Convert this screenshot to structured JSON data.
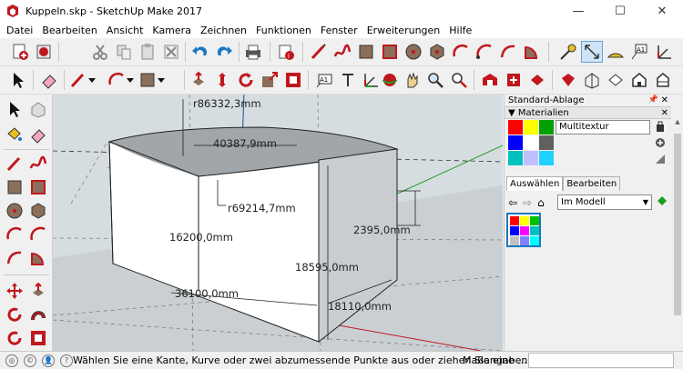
{
  "window": {
    "title": "Kuppeln.skp - SketchUp Make 2017",
    "minimize_glyph": "—",
    "maximize_glyph": "☐",
    "close_glyph": "✕"
  },
  "menu": [
    "Datei",
    "Bearbeiten",
    "Ansicht",
    "Kamera",
    "Zeichnen",
    "Funktionen",
    "Fenster",
    "Erweiterungen",
    "Hilfe"
  ],
  "viewport": {
    "dimensions": [
      "r86332,3mm",
      "40387,9mm",
      "r69214,7mm",
      "16200,0mm",
      "2395,0mm",
      "18595,0mm",
      "36100,0mm",
      "18110,0mm"
    ]
  },
  "tray": {
    "title": "Standard-Ablage",
    "panel_header": "▼ Materialien",
    "material_name": "Multitextur",
    "tabs": [
      "Auswählen",
      "Bearbeiten"
    ],
    "collection_select": "Im Modell",
    "swatches": [
      "#ff0000",
      "#ffff00",
      "#00a000",
      "#0000ff",
      "#ffffff",
      "#606060",
      "#00c0c0",
      "#c0c0ff",
      "#20d0ff"
    ],
    "thumb_swatches": [
      "#ff0000",
      "#ffff00",
      "#00c000",
      "#0000ff",
      "#ff00ff",
      "#00c0c0",
      "#c0c0c0",
      "#8080ff",
      "#00ffff"
    ]
  },
  "status": {
    "message": "Wählen Sie eine Kante, Kurve oder zwei abzumessende Punkte aus oder ziehen Sie eine ...",
    "measure_label": "Maßangaben",
    "measure_value": ""
  },
  "colors": {
    "accent_red": "#c0181e",
    "viewport_bg": "#d6dde1",
    "sky_gray": "#bfc6ca"
  },
  "icons": {
    "toolbar1": [
      "new-model-icon",
      "open-icon",
      "cut-icon",
      "copy-icon",
      "paste-icon",
      "erase-icon",
      "undo-icon",
      "redo-icon",
      "print-icon",
      "model-info-icon",
      "line-icon",
      "freehand-icon",
      "rectangle-icon",
      "rotated-rect-icon",
      "circle-icon",
      "polygon-icon",
      "arc-icon",
      "two-point-arc-icon",
      "three-point-arc-icon",
      "pie-icon",
      "tape-measure-icon",
      "dimension-icon",
      "protractor-icon",
      "text-icon"
    ],
    "toolbar2": [
      "select-icon",
      "eraser-icon",
      "pencil-icon",
      "arc-tool-icon",
      "rectangle-tool-icon",
      "push-pull-icon",
      "move-icon",
      "rotate-icon",
      "scale-icon",
      "offset-icon",
      "tape-icon",
      "text-tool-icon",
      "axes-icon",
      "3d-text-icon",
      "orbit-icon",
      "pan-icon",
      "zoom-icon",
      "zoom-extents-icon",
      "warehouse-icon",
      "extension-icon",
      "ruby-icon",
      "iso-view-icon",
      "top-view-icon",
      "front-view-icon",
      "right-view-icon"
    ]
  }
}
